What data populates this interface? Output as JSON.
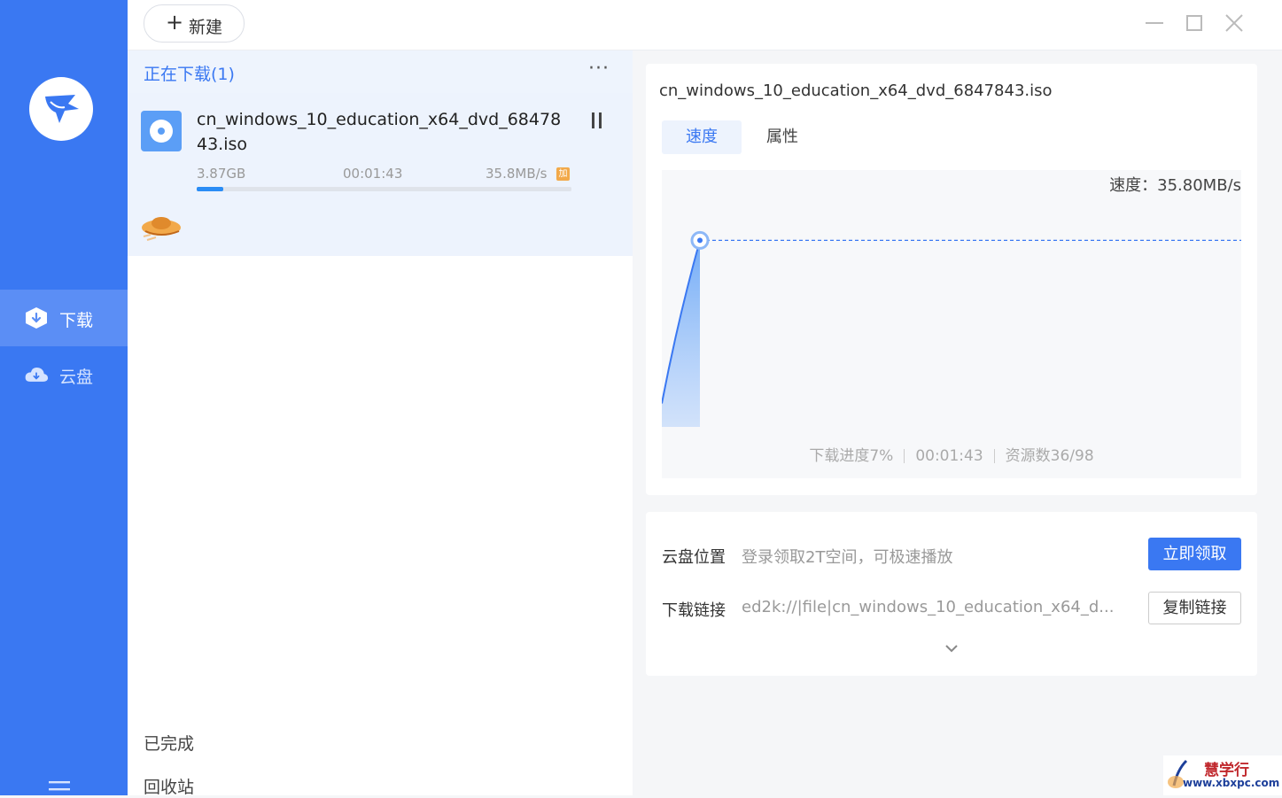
{
  "sidebar": {
    "logo_icon": "bird-logo-icon",
    "items": [
      {
        "label": "下载",
        "icon": "download-shield-icon",
        "active": true
      },
      {
        "label": "云盘",
        "icon": "cloud-icon",
        "active": false
      }
    ],
    "menu_icon": "hamburger-menu-icon",
    "color": "#3a78f2"
  },
  "toolbar": {
    "new_label": "新建",
    "window_controls": [
      "minimize-icon",
      "maximize-icon",
      "close-icon"
    ]
  },
  "list": {
    "downloading_header": "正在下载(1)",
    "more_label": "···",
    "task": {
      "name": "cn_windows_10_education_x64_dvd_6847843.iso",
      "size": "3.87GB",
      "elapsed": "00:01:43",
      "speed": "35.8MB/s",
      "progress_percent": 7,
      "badge": "加"
    },
    "completed_label": "已完成",
    "recycle_label": "回收站"
  },
  "detail": {
    "file_name": "cn_windows_10_education_x64_dvd_6847843.iso",
    "tabs": [
      {
        "label": "速度",
        "active": true
      },
      {
        "label": "属性",
        "active": false
      }
    ],
    "speed_text": "速度：35.80MB/s",
    "stats": [
      "下载进度7%",
      "00:01:43",
      "资源数36/98"
    ]
  },
  "chart_data": {
    "type": "area",
    "title": "",
    "series": [
      {
        "values": [
          0,
          35.8,
          35.8
        ]
      }
    ],
    "current_speed_mb": 35.8,
    "accent": "#3a78f2"
  },
  "info": {
    "cloud_location_label": "云盘位置",
    "cloud_location_value": "登录领取2T空间，可极速播放",
    "claim_button": "立即领取",
    "download_link_label": "下载链接",
    "download_link_value": "ed2k://|file|cn_windows_10_education_x64_d...",
    "copy_button": "复制链接"
  },
  "watermark": {
    "cn": "慧学行",
    "url": "www.xbxpc.com"
  }
}
